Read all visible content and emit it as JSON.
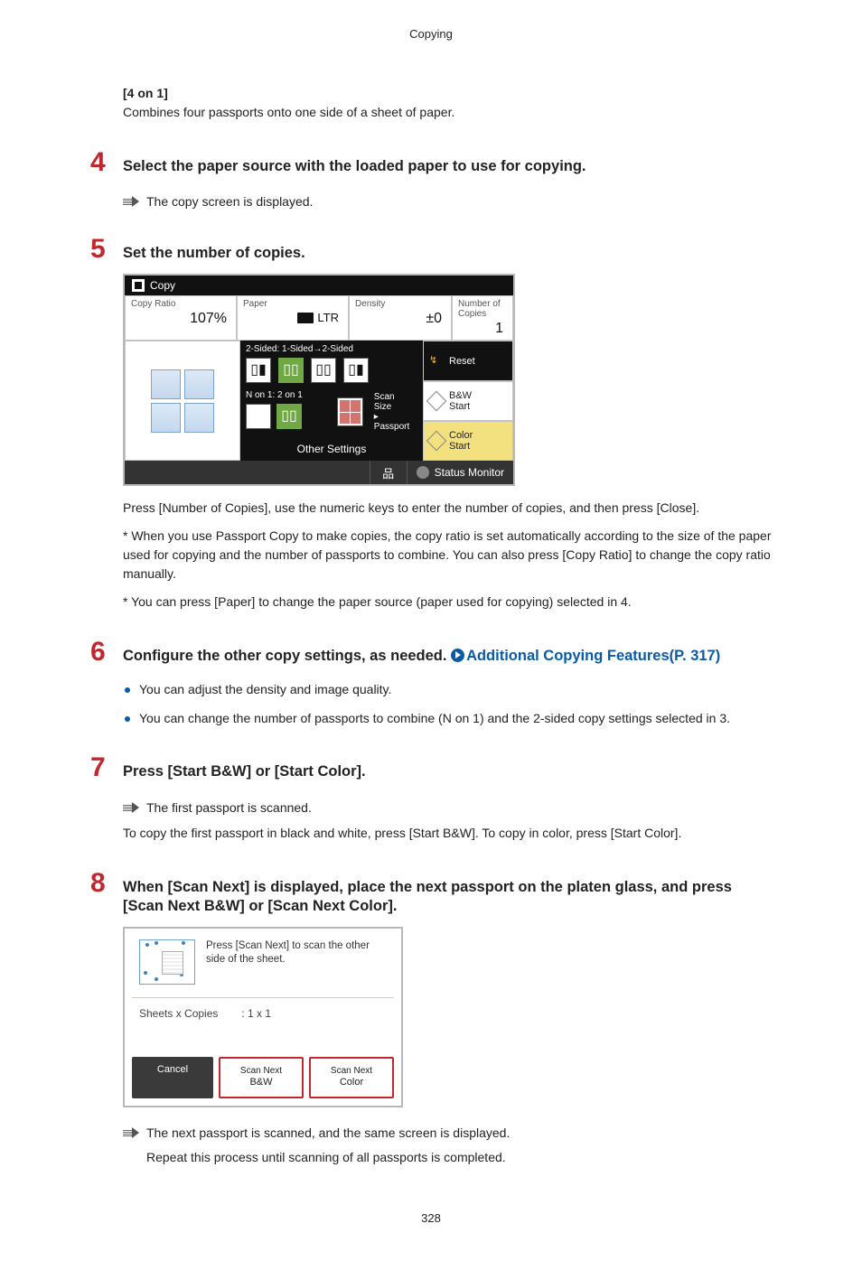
{
  "header": {
    "title": "Copying"
  },
  "section_3_sub": {
    "heading": "[4 on 1]",
    "text": "Combines four passports onto one side of a sheet of paper."
  },
  "step4": {
    "num": "4",
    "title": "Select the paper source with the loaded paper to use for copying.",
    "result": "The copy screen is displayed."
  },
  "step5": {
    "num": "5",
    "title": "Set the number of copies.",
    "p1": "Press [Number of Copies], use the numeric keys to enter the number of copies, and then press [Close].",
    "p2": "* When you use Passport Copy to make copies, the copy ratio is set automatically according to the size of the paper used for copying and the number of passports to combine. You can also press [Copy Ratio] to change the copy ratio manually.",
    "p3": "* You can press [Paper] to change the paper source (paper used for copying) selected in 4."
  },
  "copy_screen": {
    "title": "Copy",
    "ratio_label": "Copy Ratio",
    "ratio_value": "107%",
    "paper_label": "Paper",
    "paper_value": "LTR",
    "density_label": "Density",
    "density_value": "±0",
    "copies_label": "Number of Copies",
    "copies_value": "1",
    "row_a_title": "2-Sided: 1-Sided→2-Sided",
    "row_b_title": "N on 1: 2 on 1",
    "scan_size_label": "Scan Size",
    "scan_size_sub": "▸ Passport",
    "reset": "Reset",
    "bw_start": "B&W\nStart",
    "color_start": "Color\nStart",
    "bw_l1": "B&W",
    "bw_l2": "Start",
    "color_l1": "Color",
    "color_l2": "Start",
    "other_settings": "Other Settings",
    "status_monitor": "Status Monitor"
  },
  "step6": {
    "num": "6",
    "title_a": "Configure the other copy settings, as needed. ",
    "link_text": "Additional Copying Features(P. 317)",
    "bullet1": "You can adjust the density and image quality.",
    "bullet2": "You can change the number of passports to combine (N on 1) and the 2-sided copy settings selected in 3."
  },
  "step7": {
    "num": "7",
    "title": "Press [Start B&W] or [Start Color].",
    "result": "The first passport is scanned.",
    "p1": "To copy the first passport in black and white, press [Start B&W]. To copy in color, press [Start Color]."
  },
  "step8": {
    "num": "8",
    "title": "When [Scan Next] is displayed, place the next passport on the platen glass, and press [Scan Next B&W] or [Scan Next Color].",
    "result": "The next passport is scanned, and the same screen is displayed.",
    "p1": "Repeat this process until scanning of all passports is completed."
  },
  "scan_screen": {
    "instruction": "Press [Scan Next] to scan the other side of the sheet.",
    "mid_label": "Sheets x Copies",
    "mid_value": ": 1 x 1",
    "cancel": "Cancel",
    "scan_next": "Scan Next",
    "bw": "B&W",
    "color": "Color"
  },
  "page_number": "328"
}
